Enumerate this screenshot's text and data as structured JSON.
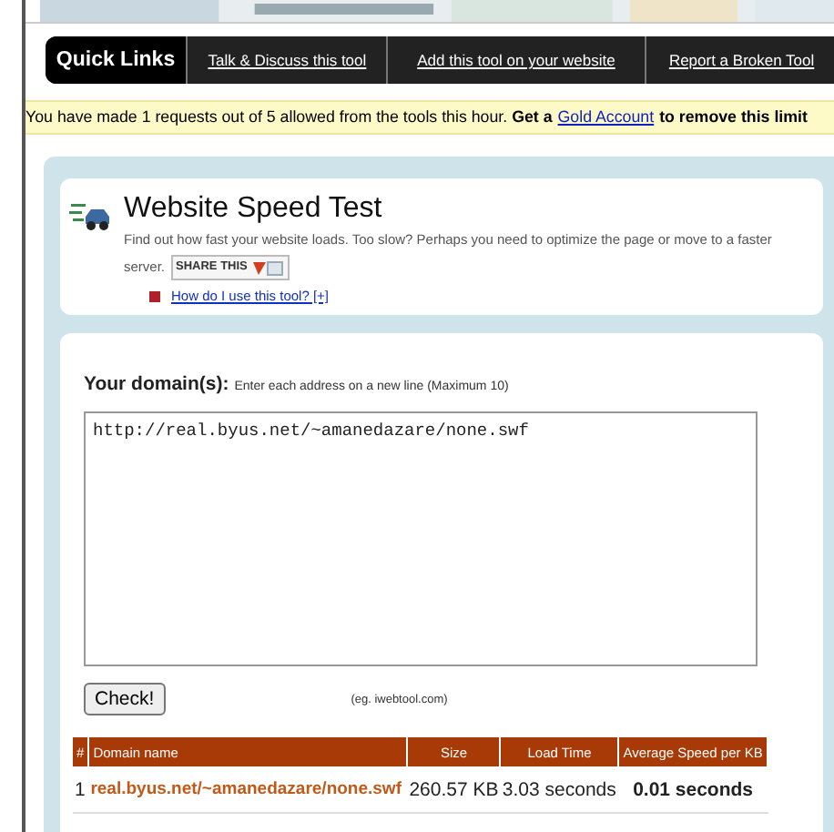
{
  "quick_links": {
    "title": "Quick Links",
    "links": [
      "Talk & Discuss this tool",
      "Add this tool on your website",
      "Report a Broken Tool"
    ]
  },
  "notice": {
    "text": "You have made 1 requests out of 5 allowed from the tools this hour. **Get a**",
    "link": "Gold Account",
    "after": "to remove this limit"
  },
  "tool": {
    "title": "Website Speed Test",
    "description": [
      "Find out how fast your website loads. Too slow? Perhaps you need to optimize the page or move to a faster",
      "server."
    ],
    "share": "SHARE THIS",
    "help_link": "How do I use this tool? [+]"
  },
  "form": {
    "label": "Your domain(s):",
    "hint": "Enter each address on a new line (Maximum 10)",
    "value": "http://real.byus.net/~amanedazare/none.swf",
    "button": "Check!",
    "example": "(eg. iwebtool.com)"
  },
  "table": {
    "columns": [
      "#",
      "Domain name",
      "Size",
      "Load Time",
      "Average Speed per KB"
    ],
    "rows": [
      {
        "index": "1",
        "domain": "real.byus.net/~amanedazare/none.swf",
        "size": "260.57 KB",
        "load_time": "3.03 seconds",
        "speed": "0.01 seconds"
      }
    ]
  }
}
